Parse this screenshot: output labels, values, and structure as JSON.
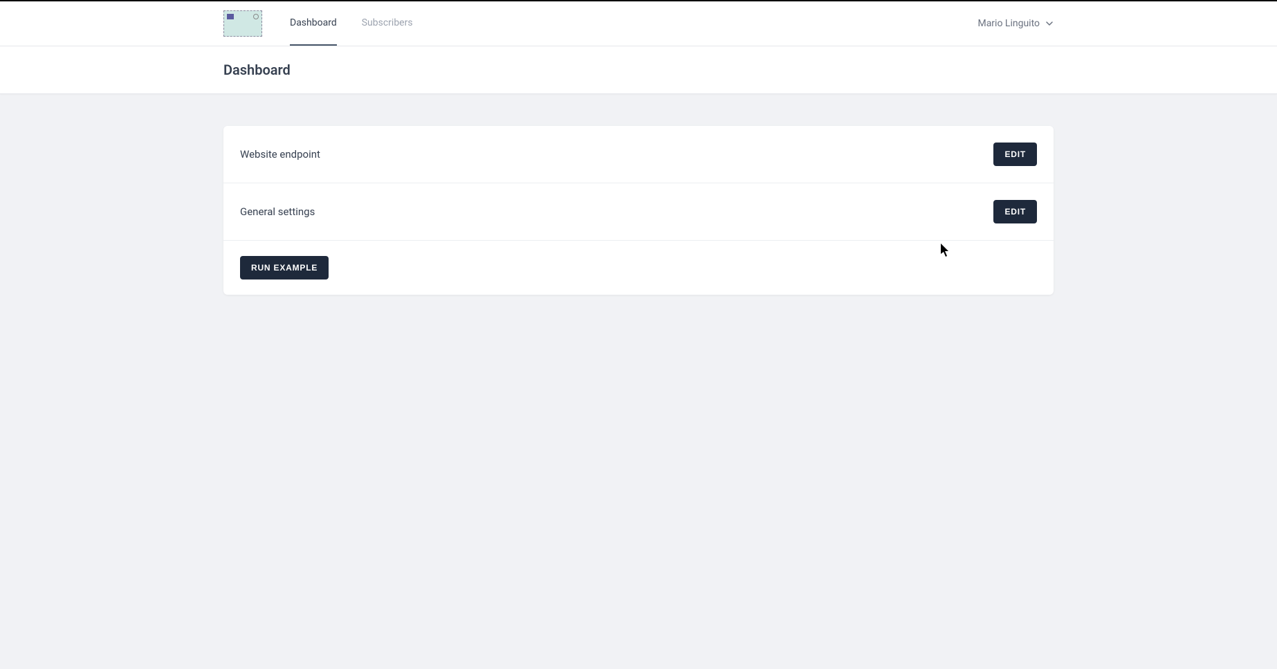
{
  "nav": {
    "items": [
      {
        "label": "Dashboard",
        "active": true
      },
      {
        "label": "Subscribers",
        "active": false
      }
    ]
  },
  "user": {
    "name": "Mario Linguito"
  },
  "page": {
    "title": "Dashboard"
  },
  "settings": {
    "rows": [
      {
        "label": "Website endpoint",
        "action": "EDIT"
      },
      {
        "label": "General settings",
        "action": "EDIT"
      }
    ],
    "run_example_label": "RUN EXAMPLE"
  }
}
